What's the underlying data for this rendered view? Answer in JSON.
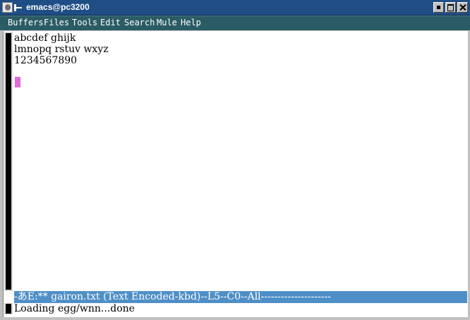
{
  "window": {
    "title": "emacs@pc3200"
  },
  "menubar": {
    "items": [
      "Buffers",
      "Files",
      "Tools",
      "Edit",
      "Search",
      "Mule",
      "Help"
    ]
  },
  "buffer": {
    "lines": [
      "abcdef ghijk",
      "lmnopq rstuv wxyz",
      "1234567890"
    ]
  },
  "modeline": {
    "text": "-あE:**  gairon.txt      (Text Encoded-kbd)--L5--C0--All---------------------"
  },
  "minibuffer": {
    "text": "Loading egg/wnn...done"
  },
  "colors": {
    "titlebar": "#1f4e86",
    "menubar": "#2b5b64",
    "modeline": "#4f8fc7",
    "cursor": "#e06ad6"
  }
}
